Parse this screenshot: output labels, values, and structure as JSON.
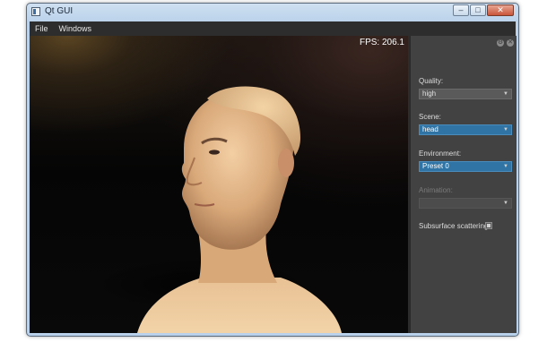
{
  "window": {
    "title": "Qt GUI",
    "minimize_glyph": "–",
    "maximize_glyph": "□",
    "close_glyph": "✕"
  },
  "menu": {
    "items": [
      "File",
      "Windows"
    ]
  },
  "viewport": {
    "fps_text": "FPS: 206.1",
    "scene_subject": "head"
  },
  "panel": {
    "settings_glyph": "⚙",
    "close_glyph": "✕",
    "quality": {
      "label": "Quality:",
      "value": "high"
    },
    "scene": {
      "label": "Scene:",
      "value": "head"
    },
    "environment": {
      "label": "Environment:",
      "value": "Preset 0"
    },
    "animation": {
      "label": "Animation:",
      "value": ""
    },
    "subsurface": {
      "label": "Subsurface scattering",
      "checked": true
    }
  },
  "icons": {
    "dropdown": "chevron-down-icon",
    "settings": "gear-icon",
    "close": "close-icon"
  }
}
